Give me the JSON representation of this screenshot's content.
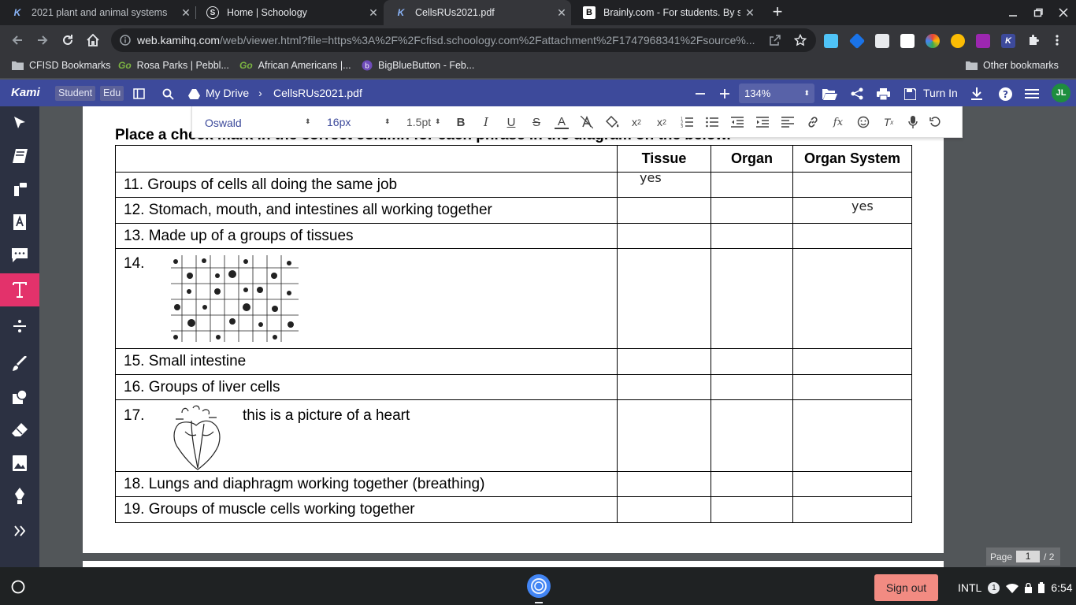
{
  "browser": {
    "tabs": [
      {
        "label": "2021 plant and animal systems",
        "favicon": "K"
      },
      {
        "label": "Home | Schoology",
        "favicon": "S"
      },
      {
        "label": "CellsRUs2021.pdf",
        "favicon": "K"
      },
      {
        "label": "Brainly.com - For students. By st",
        "favicon": "B"
      }
    ],
    "url_host": "web.kamihq.com",
    "url_path": "/web/viewer.html?file=https%3A%2F%2Fcfisd.schoology.com%2Fattachment%2F1747968341%2Fsource%...",
    "bookmarks": [
      {
        "label": "CFISD Bookmarks"
      },
      {
        "label": "Rosa Parks | Pebbl..."
      },
      {
        "label": "African Americans |..."
      },
      {
        "label": "BigBlueButton - Feb..."
      }
    ],
    "other_bookmarks": "Other bookmarks"
  },
  "kami": {
    "logo": "Kami",
    "chip_student": "Student",
    "chip_edu": "Edu",
    "drive": "My Drive",
    "filename": "CellsRUs2021.pdf",
    "zoom": "134%",
    "turn_in": "Turn In",
    "avatar": "JL"
  },
  "format_toolbar": {
    "font": "Oswald",
    "size": "16px",
    "line": "1.5pt"
  },
  "worksheet": {
    "heading": "Place a check mark in the correct column for each phrase in the diagram on the below.",
    "columns": [
      "",
      "Tissue",
      "Organ",
      "Organ System"
    ],
    "rows": [
      {
        "label": "11. Groups of cells all doing the same job",
        "tissue": "yes",
        "organ": "",
        "system": ""
      },
      {
        "label": "12. Stomach, mouth, and intestines all working together",
        "tissue": "",
        "organ": "",
        "system": "yes"
      },
      {
        "label": "13. Made up of a groups of tissues",
        "tissue": "",
        "organ": "",
        "system": ""
      },
      {
        "label": "14.",
        "tissue": "",
        "organ": "",
        "system": ""
      },
      {
        "label": "15. Small intestine",
        "tissue": "",
        "organ": "",
        "system": ""
      },
      {
        "label": "16. Groups of liver cells",
        "tissue": "",
        "organ": "",
        "system": ""
      },
      {
        "label": "17.",
        "note": "this is a picture of a heart",
        "tissue": "",
        "organ": "",
        "system": ""
      },
      {
        "label": "18. Lungs and diaphragm working together (breathing)",
        "tissue": "",
        "organ": "",
        "system": ""
      },
      {
        "label": "19. Groups of muscle cells working together",
        "tissue": "",
        "organ": "",
        "system": ""
      }
    ]
  },
  "pager": {
    "label": "Page",
    "current": "1",
    "total": "/ 2"
  },
  "shelf": {
    "sign_out": "Sign out",
    "ime": "INTL",
    "notif_count": "1",
    "time": "6:54"
  }
}
